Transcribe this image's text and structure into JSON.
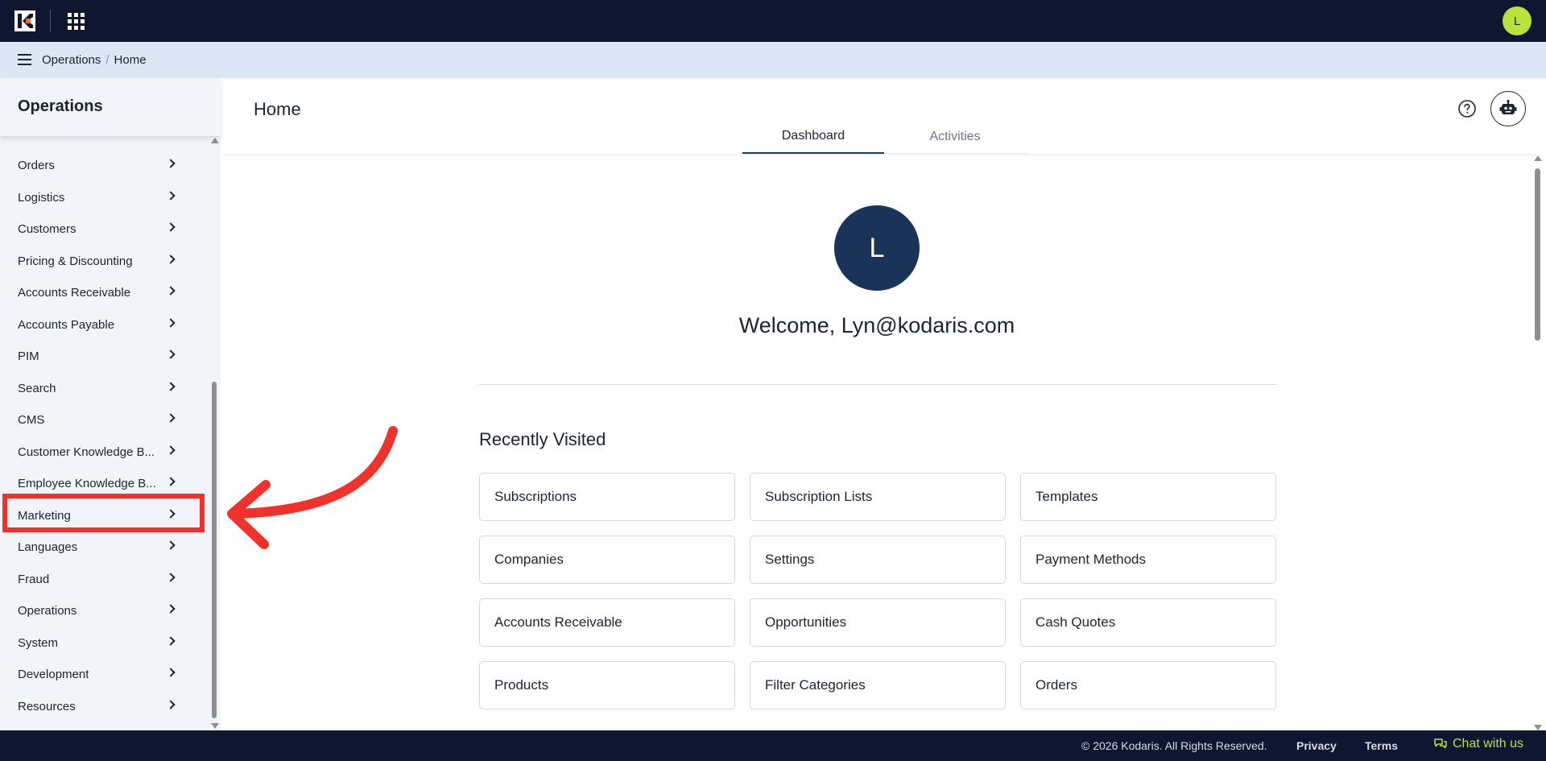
{
  "topbar": {
    "logo_icon": "kodaris-logo-icon",
    "apps_icon": "apps-grid-icon",
    "user_initial": "L",
    "brand_color": "#0f1730",
    "avatar_color": "#b7e33b"
  },
  "breadcrumb": {
    "menu_icon": "hamburger-menu-icon",
    "items": [
      "Operations",
      "Home"
    ],
    "separator": "/"
  },
  "sidebar": {
    "title": "Operations",
    "items": [
      {
        "label": "Orders"
      },
      {
        "label": "Logistics"
      },
      {
        "label": "Customers"
      },
      {
        "label": "Pricing & Discounting"
      },
      {
        "label": "Accounts Receivable"
      },
      {
        "label": "Accounts Payable"
      },
      {
        "label": "PIM"
      },
      {
        "label": "Search"
      },
      {
        "label": "CMS"
      },
      {
        "label": "Customer Knowledge B..."
      },
      {
        "label": "Employee Knowledge B..."
      },
      {
        "label": "Marketing"
      },
      {
        "label": "Languages"
      },
      {
        "label": "Fraud"
      },
      {
        "label": "Operations"
      },
      {
        "label": "System"
      },
      {
        "label": "Development"
      },
      {
        "label": "Resources"
      }
    ],
    "highlighted_item": "Marketing",
    "highlight_color": "#f0322a"
  },
  "main": {
    "page_title": "Home",
    "tabs": [
      {
        "label": "Dashboard",
        "active": true
      },
      {
        "label": "Activities",
        "active": false
      }
    ],
    "welcome_initial": "L",
    "welcome_text": "Welcome, Lyn@kodaris.com",
    "recent_title": "Recently Visited",
    "recent_items": [
      "Subscriptions",
      "Subscription Lists",
      "Templates",
      "Companies",
      "Settings",
      "Payment Methods",
      "Accounts Receivable",
      "Opportunities",
      "Cash Quotes",
      "Products",
      "Filter Categories",
      "Orders"
    ],
    "accent_color": "#1a3358"
  },
  "footer": {
    "copyright": "© 2026 Kodaris. All Rights Reserved.",
    "privacy": "Privacy",
    "terms": "Terms",
    "chat": "Chat with us",
    "chat_color": "#b7e33b"
  }
}
